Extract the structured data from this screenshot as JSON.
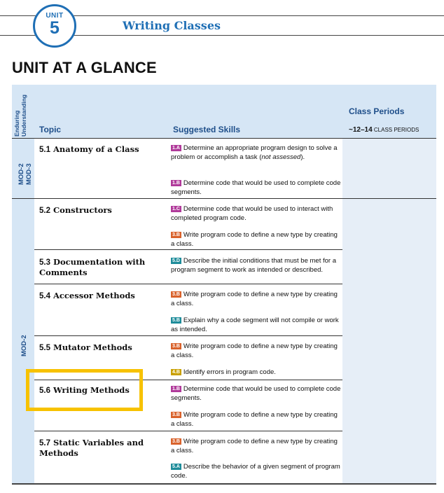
{
  "header": {
    "unit_label": "UNIT",
    "unit_number": "5",
    "unit_title": "Writing Classes"
  },
  "page_title": "UNIT AT A GLANCE",
  "table": {
    "col_enduring": "Enduring Understanding",
    "col_topic": "Topic",
    "col_skills": "Suggested Skills",
    "col_periods": "Class Periods",
    "periods_value": "~12–14",
    "periods_unit": "CLASS PERIODS",
    "mod_groups": [
      "MOD-2 MOD-3",
      "MOD-2"
    ],
    "topics": [
      {
        "num": "5.1",
        "title": "Anatomy of a Class",
        "skills": [
          {
            "tag": "1.A",
            "color": "#b03a9a",
            "text": "Determine an appropriate program design to solve a problem or accomplish a task (",
            "italic": "not assessed",
            "after": ")."
          },
          {
            "tag": "1.B",
            "color": "#b03a9a",
            "text": "Determine code that would be used to complete code segments."
          }
        ]
      },
      {
        "num": "5.2",
        "title": "Constructors",
        "skills": [
          {
            "tag": "1.C",
            "color": "#b03a9a",
            "text": "Determine code that would be used to interact with completed program code."
          },
          {
            "tag": "3.B",
            "color": "#d9622b",
            "text": "Write program code to define a new type by creating a class."
          }
        ]
      },
      {
        "num": "5.3",
        "title": "Documentation with Comments",
        "skills": [
          {
            "tag": "5.D",
            "color": "#1e8c9a",
            "text": "Describe the initial conditions that must be met for a program segment to work as intended or described."
          }
        ]
      },
      {
        "num": "5.4",
        "title": "Accessor Methods",
        "skills": [
          {
            "tag": "3.B",
            "color": "#d9622b",
            "text": "Write program code to define a new type by creating a class."
          },
          {
            "tag": "5.B",
            "color": "#1e8c9a",
            "text": "Explain why a code segment will not compile or work as intended."
          }
        ]
      },
      {
        "num": "5.5",
        "title": "Mutator Methods",
        "skills": [
          {
            "tag": "3.B",
            "color": "#d9622b",
            "text": "Write program code to define a new type by creating a class."
          },
          {
            "tag": "4.B",
            "color": "#c9a000",
            "text": "Identify errors in program code."
          }
        ]
      },
      {
        "num": "5.6",
        "title": "Writing Methods",
        "skills": [
          {
            "tag": "1.B",
            "color": "#b03a9a",
            "text": "Determine code that would be used to complete code segments."
          },
          {
            "tag": "3.B",
            "color": "#d9622b",
            "text": "Write program code to define a new type by creating a class."
          }
        ]
      },
      {
        "num": "5.7",
        "title": "Static Variables and Methods",
        "skills": [
          {
            "tag": "3.B",
            "color": "#d9622b",
            "text": "Write program code to define a new type by creating a class."
          },
          {
            "tag": "5.A",
            "color": "#1e8c9a",
            "text": "Describe the behavior of a given segment of program code."
          }
        ]
      }
    ]
  },
  "colors": {
    "brand_blue": "#1f6fb5",
    "header_bg": "#d6e6f5",
    "highlight": "#f7c200"
  }
}
